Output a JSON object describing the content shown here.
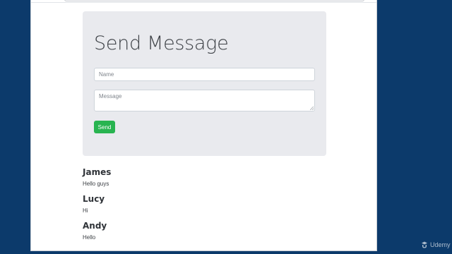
{
  "form": {
    "title": "Send Message",
    "name_placeholder": "Name",
    "message_placeholder": "Message",
    "send_label": "Send"
  },
  "messages": [
    {
      "author": "James",
      "text": "Hello guys"
    },
    {
      "author": "Lucy",
      "text": "Hi"
    },
    {
      "author": "Andy",
      "text": "Hello"
    }
  ],
  "watermark": {
    "label": "Udemy"
  },
  "colors": {
    "desktop_background": "#0c3a6b",
    "panel_background": "#e9eaee",
    "send_button": "#28b450"
  }
}
